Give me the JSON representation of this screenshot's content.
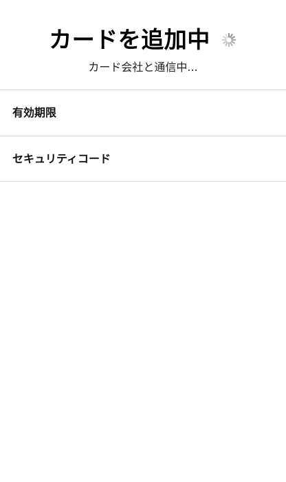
{
  "header": {
    "title": "カードを追加中",
    "subtitle": "カード会社と通信中..."
  },
  "form": {
    "fields": [
      {
        "label": "有効期限"
      },
      {
        "label": "セキュリティコード"
      }
    ]
  },
  "icons": {
    "spinner": "activity-indicator-icon"
  },
  "colors": {
    "divider": "#d9d9d9",
    "spinner": "#8e8e93"
  }
}
